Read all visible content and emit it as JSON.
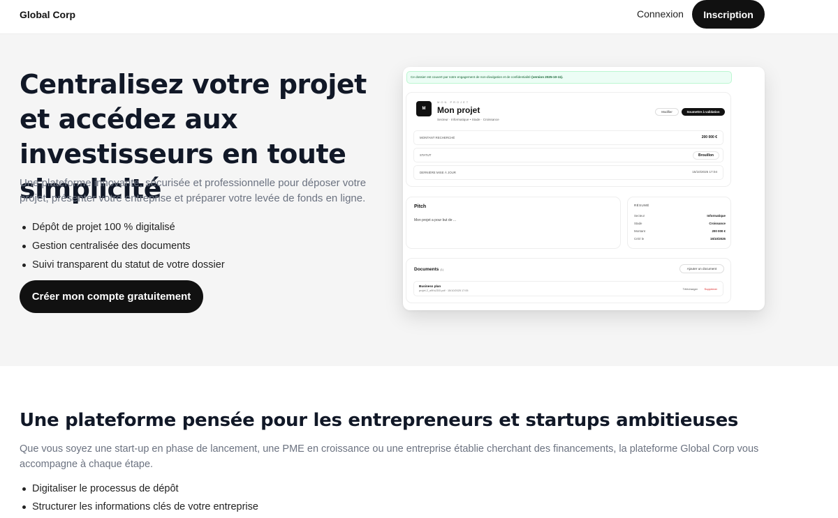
{
  "nav": {
    "brand": "Global Corp",
    "login": "Connexion",
    "signup": "Inscription"
  },
  "hero": {
    "title": "Centralisez votre projet et accédez aux investisseurs en toute simplicité",
    "description": "Une plateforme innovante, sécurisée et professionnelle pour déposer votre projet, présenter votre entreprise et préparer votre levée de fonds en ligne.",
    "features": [
      "Dépôt de projet 100 % digitalisé",
      "Gestion centralisée des documents",
      "Suivi transparent du statut de votre dossier"
    ],
    "cta": "Créer mon compte gratuitement"
  },
  "preview": {
    "notice_text": "Ce dossier est couvert par notre engagement de non-divulgation et de confidentialité",
    "notice_version": "(version 2025-10-11).",
    "logo_letter": "M",
    "kicker": "MON PROJET",
    "project_title": "Mon projet",
    "subtitle": "Secteur · Informatique  •  Stade · Croissance",
    "modify_label": "Modifier",
    "submit_label": "Soumettre à validation",
    "rows": [
      {
        "label": "MONTANT RECHERCHÉ",
        "value": "200 000 €"
      },
      {
        "label": "STATUT",
        "value": "Brouillon"
      },
      {
        "label": "DERNIÈRE MISE À JOUR",
        "value": "15/10/2025 17:04"
      }
    ],
    "pitch_heading": "Pitch",
    "pitch_text": "Mon projet a pour but de ...",
    "summary_heading": "RÉSUMÉ",
    "summary": [
      {
        "label": "Secteur",
        "value": "Informatique"
      },
      {
        "label": "Stade",
        "value": "Croissance"
      },
      {
        "label": "Montant",
        "value": "200 000 €"
      },
      {
        "label": "Créé le",
        "value": "15/10/2025"
      }
    ],
    "docs_heading": "Documents",
    "docs_count": "(1)",
    "add_doc_label": "Ajouter un document",
    "doc_name": "Business plan",
    "doc_meta": "projet-2_a9Ks2DD.pdf · 15/10/2025 17:05",
    "download_label": "Télécharger",
    "delete_label": "Supprimer"
  },
  "section2": {
    "title": "Une plateforme pensée pour les entrepreneurs et startups ambitieuses",
    "description": "Que vous soyez une start-up en phase de lancement, une PME en croissance ou une entreprise établie cherchant des financements, la plateforme Global Corp vous accompagne à chaque étape.",
    "items": [
      "Digitaliser le processus de dépôt",
      "Structurer les informations clés de votre entreprise"
    ]
  }
}
